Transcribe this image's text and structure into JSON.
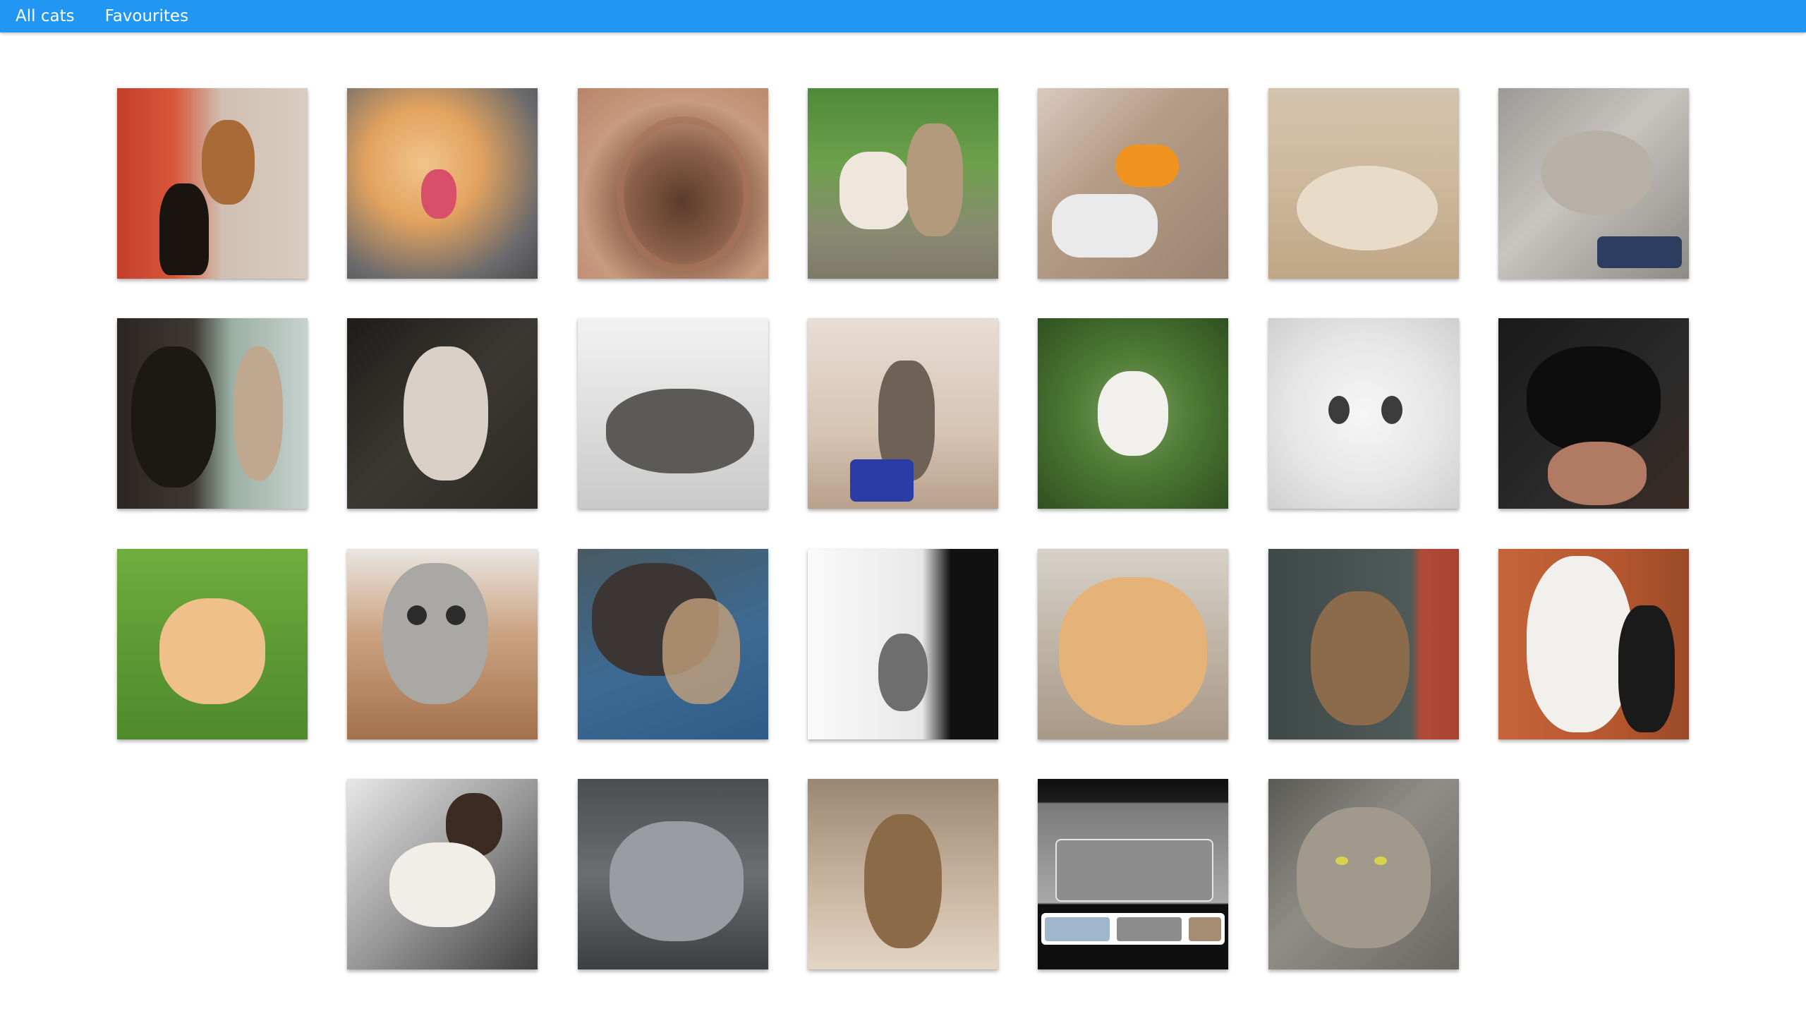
{
  "nav": {
    "all_cats_label": "All cats",
    "favourites_label": "Favourites"
  },
  "colors": {
    "topbar": "#2196f3",
    "nav_text": "#ffffff",
    "background": "#ffffff"
  },
  "gallery": {
    "items": [
      {
        "subject": "black cat and monkey on steps"
      },
      {
        "subject": "orange kitten yawning"
      },
      {
        "subject": "sepia cat in woven basket"
      },
      {
        "subject": "two kittens hugging on grass"
      },
      {
        "subject": "kittens with milk bottle"
      },
      {
        "subject": "cream kittens sleeping"
      },
      {
        "subject": "tabby cat sleeping on snoopy pillow"
      },
      {
        "subject": "cats at window"
      },
      {
        "subject": "calico kitten sitting"
      },
      {
        "subject": "tabby cat wearing tie on floor"
      },
      {
        "subject": "kitten climbing pole"
      },
      {
        "subject": "white kitten in tree leaves"
      },
      {
        "subject": "white cat face close-up"
      },
      {
        "subject": "black kittens held in hands"
      },
      {
        "subject": "orange cat jumping on grass"
      },
      {
        "subject": "grey cat surprised at table"
      },
      {
        "subject": "dark cat sleeping on blanket"
      },
      {
        "subject": "kitten walking in black and white"
      },
      {
        "subject": "orange cat lying on back"
      },
      {
        "subject": "long-haired cat sitting outside"
      },
      {
        "subject": "white maine coon held by woman"
      },
      {
        "subject": "boy holding white cat on sofa"
      },
      {
        "subject": "fluffy grey cat on chair"
      },
      {
        "subject": "tabby cat on bed"
      },
      {
        "subject": "phone screenshot of cat search"
      },
      {
        "subject": "maine coon cat close-up"
      }
    ]
  }
}
